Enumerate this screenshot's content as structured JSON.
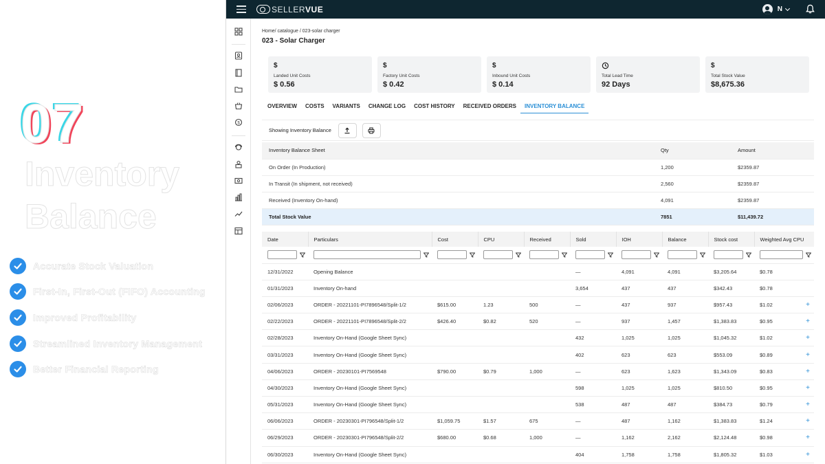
{
  "promo": {
    "number": "07",
    "title_line1": "Inventory",
    "title_line2": "Balance",
    "features": [
      "Accurate Stock Valuation",
      "First-In, First-Out (FIFO) Accounting",
      "Improved Profitability",
      "Streamlined Inventory Management",
      "Better Financial Reporting"
    ]
  },
  "topbar": {
    "logo_light": "SELLER",
    "logo_bold": "VUE",
    "user_initial": "N"
  },
  "page": {
    "breadcrumb": "Home/ catalogue  / 023-solar charger",
    "title": "023 - Solar Charger"
  },
  "cards": [
    {
      "icon": "$",
      "label": "Landed Unit Costs",
      "value": "$ 0.56"
    },
    {
      "icon": "$",
      "label": "Factory Unit Costs",
      "value": "$ 0.42"
    },
    {
      "icon": "$",
      "label": "Inbound Unit Costs",
      "value": "$ 0.14"
    },
    {
      "icon": "clock-icon",
      "label": "Total Lead Time",
      "value": "92 Days"
    },
    {
      "icon": "$",
      "label": "Total Stock Value",
      "value": "$8,675.36"
    }
  ],
  "tabs": [
    "OVERVIEW",
    "COSTS",
    "VARIANTS",
    "CHANGE LOG",
    "COST HISTORY",
    "RECEIVED ORDERS",
    "INVENTORY BALANCE"
  ],
  "active_tab": "INVENTORY BALANCE",
  "toolbar": {
    "label": "Showing Inventory Balance"
  },
  "balance": {
    "headers": [
      "Inventory Balance Sheet",
      "Qty",
      "Amount"
    ],
    "rows": [
      [
        "On Order (In Production)",
        "1,200",
        "$2359.87"
      ],
      [
        "In Transit (In shipment, not received)",
        "2,560",
        "$2359.87"
      ],
      [
        "Received (Inventory On-hand)",
        "4,091",
        "$2359.87"
      ]
    ],
    "total": [
      "Total Stock Value",
      "7851",
      "$11,439.72"
    ]
  },
  "ledger": {
    "headers": [
      "Date",
      "Particulars",
      "Cost",
      "CPU",
      "Received",
      "Sold",
      "IOH",
      "Balance",
      "Stock cost",
      "Weighted Avg CPU"
    ],
    "rows": [
      [
        "12/31/2022",
        "Opening Balance",
        "",
        "",
        "",
        "—",
        "4,091",
        "4,091",
        "$3,205.64",
        "$0.78",
        ""
      ],
      [
        "01/31/2023",
        "Inventory On-hand",
        "",
        "",
        "",
        "3,654",
        "437",
        "437",
        "$342.43",
        "$0.78",
        ""
      ],
      [
        "02/06/2023",
        "ORDER - 20221101-PI7896548/Split-1/2",
        "$615.00",
        "1.23",
        "500",
        "—",
        "437",
        "937",
        "$957.43",
        "$1.02",
        "+"
      ],
      [
        "02/22/2023",
        "ORDER - 20221101-PI7896548/Split-2/2",
        "$426.40",
        "$0.82",
        "520",
        "—",
        "937",
        "1,457",
        "$1,383.83",
        "$0.95",
        "+"
      ],
      [
        "02/28/2023",
        "Inventory On-Hand (Google Sheet Sync)",
        "",
        "",
        "",
        "432",
        "1,025",
        "1,025",
        "$1,045.32",
        "$1.02",
        "+"
      ],
      [
        "03/31/2023",
        "Inventory On-Hand (Google Sheet Sync)",
        "",
        "",
        "",
        "402",
        "623",
        "623",
        "$553.09",
        "$0.89",
        "+"
      ],
      [
        "04/06/2023",
        "ORDER - 20230101-PI7569548",
        "$790.00",
        "$0.79",
        "1,000",
        "—",
        "623",
        "1,623",
        "$1,343.09",
        "$0.83",
        "+"
      ],
      [
        "04/30/2023",
        "Inventory On-Hand (Google Sheet Sync)",
        "",
        "",
        "",
        "598",
        "1,025",
        "1,025",
        "$810.50",
        "$0.95",
        "+"
      ],
      [
        "05/31/2023",
        "Inventory On-Hand (Google Sheet Sync)",
        "",
        "",
        "",
        "538",
        "487",
        "487",
        "$384.73",
        "$0.79",
        "+"
      ],
      [
        "06/06/2023",
        "ORDER - 20230301-PI796548/Split-1/2",
        "$1,059.75",
        "$1.57",
        "675",
        "—",
        "487",
        "1,162",
        "$1,383.83",
        "$1.24",
        "+"
      ],
      [
        "06/29/2023",
        "ORDER - 20230301-PI796548/Split-2/2",
        "$680.00",
        "$0.68",
        "1,000",
        "—",
        "1,162",
        "2,162",
        "$2,124.48",
        "$0.98",
        "+"
      ],
      [
        "06/30/2023",
        "Inventory On-Hand (Google Sheet Sync)",
        "",
        "",
        "",
        "404",
        "1,758",
        "1,758",
        "$1,805.32",
        "$1.03",
        "+"
      ]
    ]
  },
  "colors": {
    "topbar": "#0e2630",
    "accent": "#2a8fd6",
    "check": "#2b8ee8",
    "total_row": "#e4f0fb"
  }
}
